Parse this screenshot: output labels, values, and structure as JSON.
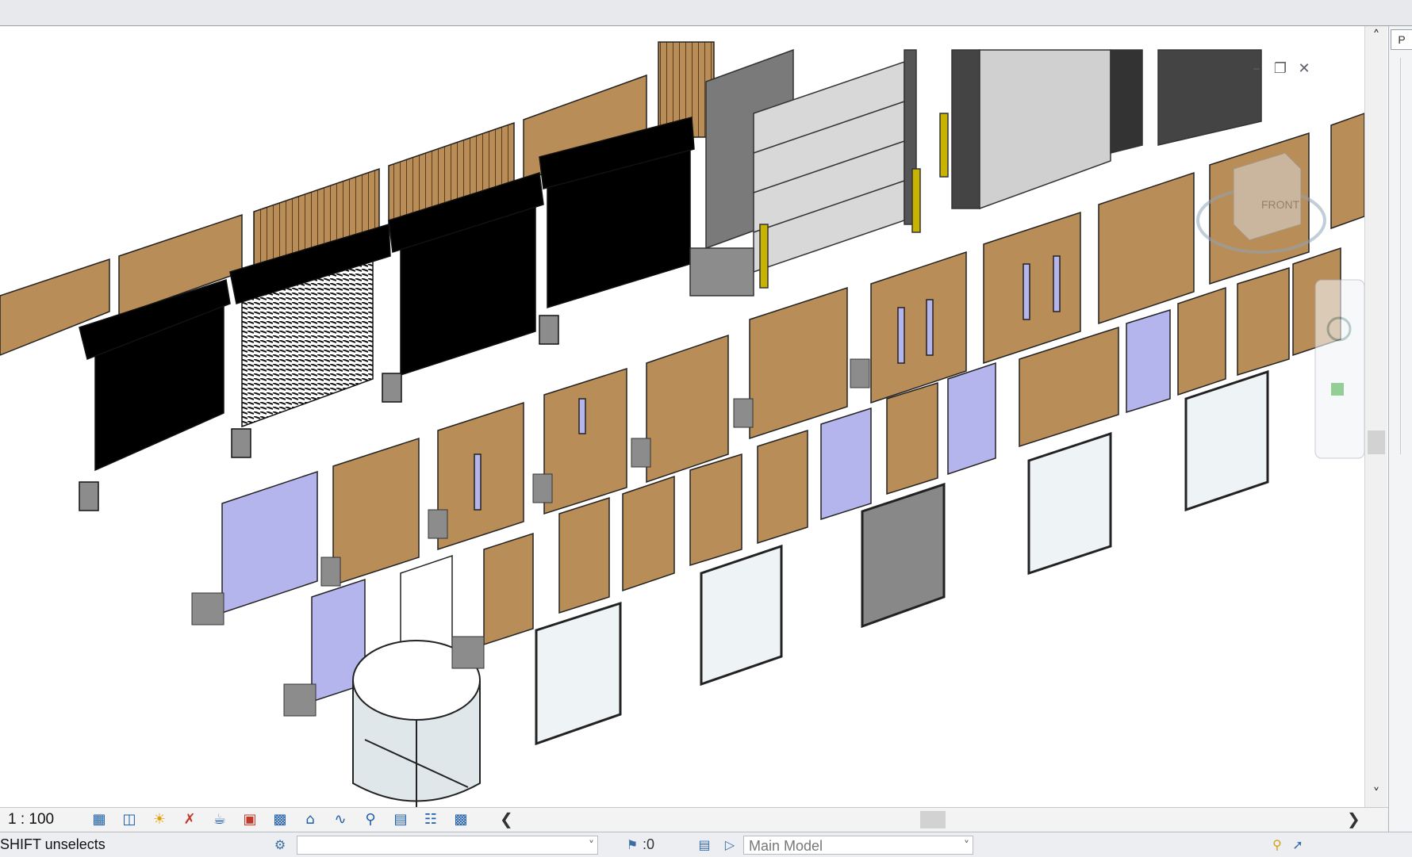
{
  "view": {
    "scale": "1 : 100",
    "viewcube_label": "FRONT",
    "window_buttons": [
      "minimize-icon",
      "restore-icon",
      "close-icon"
    ]
  },
  "view_control_icons": [
    "detail-level-icon",
    "visual-style-icon",
    "sun-path-icon",
    "shadows-icon",
    "show-rendering-icon",
    "crop-view-icon",
    "show-crop-region-icon",
    "unlock-3d-view-icon",
    "temporary-hide-isolate-icon",
    "reveal-hidden-icon",
    "analytical-model-icon",
    "highlight-displacement-icon",
    "reveal-constraints-icon",
    "worksharing-display-icon"
  ],
  "status": {
    "hint": "SHIFT unselects",
    "workset_value": "",
    "editable_count": ":0",
    "design_option": "Main Model"
  },
  "right_panel": {
    "tab_label": "P"
  },
  "colors": {
    "wood": "#b98d57",
    "wood_dark": "#8e6a3f",
    "glass_purple": "#b5b5ee",
    "shutter": "#000000",
    "concrete": "#8c8c8c",
    "post_yellow": "#c8b400"
  }
}
